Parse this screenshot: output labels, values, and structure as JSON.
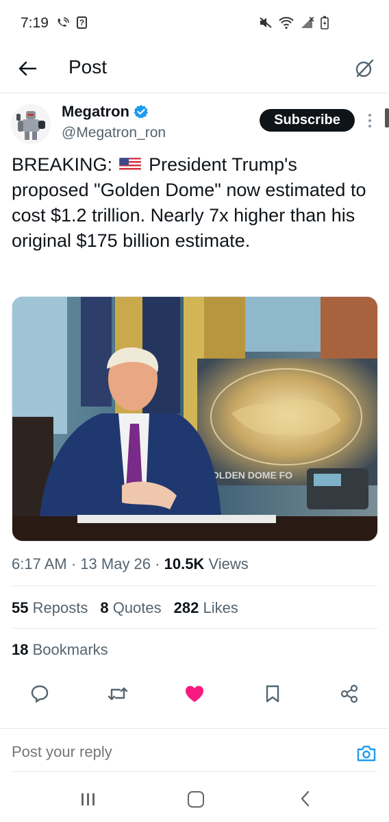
{
  "status_bar": {
    "time": "7:19"
  },
  "header": {
    "title": "Post"
  },
  "author": {
    "name": "Megatron",
    "handle": "@Megatron_ron",
    "verified": true,
    "subscribe_label": "Subscribe"
  },
  "post": {
    "text_before_flag": "BREAKING:",
    "flag_icon": "us-flag-emoji",
    "text_after_flag": "President Trump's proposed \"Golden Dome\" now estimated to cost $1.2 trillion. Nearly 7x higher than his original $175 billion estimate.",
    "image_caption_text": "GOLDEN DOME FO"
  },
  "meta": {
    "time": "6:17 AM",
    "date": "13 May 26",
    "views_count": "10.5K",
    "views_label": "Views"
  },
  "stats": {
    "reposts_count": "55",
    "reposts_label": "Reposts",
    "quotes_count": "8",
    "quotes_label": "Quotes",
    "likes_count": "282",
    "likes_label": "Likes",
    "bookmarks_count": "18",
    "bookmarks_label": "Bookmarks"
  },
  "actions": {
    "icons": [
      "reply-icon",
      "repost-icon",
      "like-icon",
      "bookmark-icon",
      "share-icon"
    ],
    "like_color": "#f91880"
  },
  "reply": {
    "placeholder": "Post your reply"
  },
  "colors": {
    "text": "#0f1419",
    "secondary": "#536471",
    "verified": "#1d9bf0",
    "divider": "#e6e9eb"
  }
}
